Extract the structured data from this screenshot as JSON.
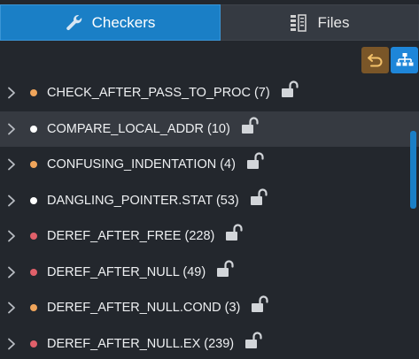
{
  "tabs": {
    "checkers_label": "Checkers",
    "files_label": "Files",
    "checkers_icon": "wrench-icon",
    "files_icon": "files-icon"
  },
  "toolbar": {
    "undo_icon": "undo-icon",
    "tree_icon": "hierarchy-icon"
  },
  "colors": {
    "accent": "#1a7fc6",
    "orange": "#f0a55b",
    "white": "#ffffff",
    "red": "#e0606a",
    "undo_bg": "#7a5628"
  },
  "checkers": [
    {
      "label": "CHECK_AFTER_PASS_TO_PROC (7)",
      "dot": "orange"
    },
    {
      "label": "COMPARE_LOCAL_ADDR (10)",
      "dot": "white"
    },
    {
      "label": "CONFUSING_INDENTATION (4)",
      "dot": "orange"
    },
    {
      "label": "DANGLING_POINTER.STAT (53)",
      "dot": "white"
    },
    {
      "label": "DEREF_AFTER_FREE (228)",
      "dot": "red"
    },
    {
      "label": "DEREF_AFTER_NULL (49)",
      "dot": "red"
    },
    {
      "label": "DEREF_AFTER_NULL.COND (3)",
      "dot": "orange"
    },
    {
      "label": "DEREF_AFTER_NULL.EX (239)",
      "dot": "red"
    }
  ]
}
